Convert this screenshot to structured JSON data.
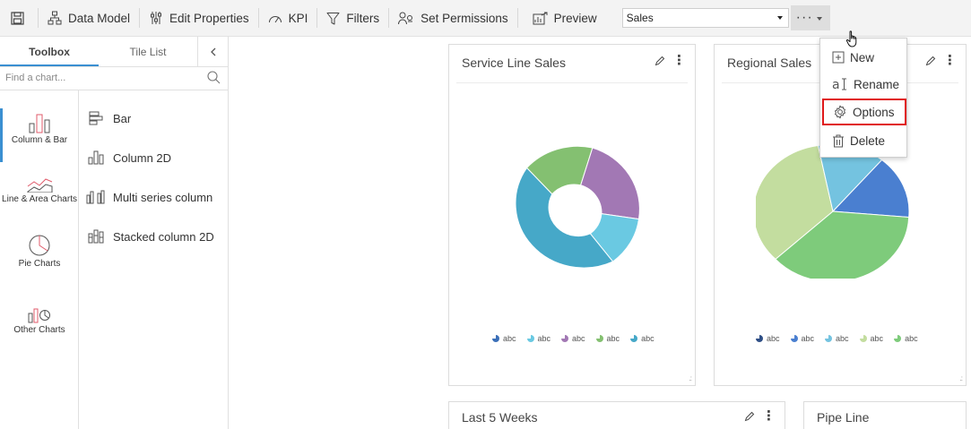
{
  "toolbar": {
    "data_model": "Data Model",
    "edit_properties": "Edit Properties",
    "kpi": "KPI",
    "filters": "Filters",
    "set_permissions": "Set Permissions",
    "preview": "Preview",
    "dashboard_select": "Sales"
  },
  "left_panel": {
    "tabs": [
      {
        "label": "Toolbox",
        "active": true
      },
      {
        "label": "Tile List",
        "active": false
      }
    ],
    "search_placeholder": "Find a chart...",
    "categories": [
      {
        "label": "Column & Bar",
        "icon": "column-bar-icon"
      },
      {
        "label": "Line & Area Charts",
        "icon": "line-area-icon"
      },
      {
        "label": "Pie Charts",
        "icon": "pie-chart-icon"
      },
      {
        "label": "Other Charts",
        "icon": "other-charts-icon"
      }
    ],
    "items": [
      {
        "label": "Bar",
        "icon": "bar-chart-icon"
      },
      {
        "label": "Column 2D",
        "icon": "column-2d-icon"
      },
      {
        "label": "Multi series column",
        "icon": "multi-series-column-icon"
      },
      {
        "label": "Stacked column 2D",
        "icon": "stacked-column-icon"
      }
    ]
  },
  "widgets": {
    "service_line": {
      "title": "Service Line Sales",
      "legend": [
        "abc",
        "abc",
        "abc",
        "abc",
        "abc"
      ]
    },
    "regional": {
      "title": "Regional Sales",
      "legend": [
        "abc",
        "abc",
        "abc",
        "abc",
        "abc"
      ]
    },
    "last_weeks": {
      "title": "Last 5 Weeks"
    },
    "pipe_line": {
      "title": "Pipe Line"
    }
  },
  "menu": {
    "items": [
      {
        "label": "New",
        "icon": "plus-box-icon"
      },
      {
        "label": "Rename",
        "icon": "rename-icon"
      },
      {
        "label": "Options",
        "icon": "gear-icon"
      },
      {
        "label": "Delete",
        "icon": "trash-icon"
      }
    ]
  },
  "colors": {
    "accent": "#3a8fd1",
    "highlight_border": "#e0191a",
    "donut_green": "#84c071",
    "donut_purple": "#a278b4",
    "donut_light_blue": "#6ac9e2",
    "donut_teal": "#46a8c8",
    "pie_light_green": "#c3dd9f",
    "pie_sky": "#74c3e0",
    "pie_blue": "#4a7fd0",
    "pie_green": "#7ecb7b"
  }
}
